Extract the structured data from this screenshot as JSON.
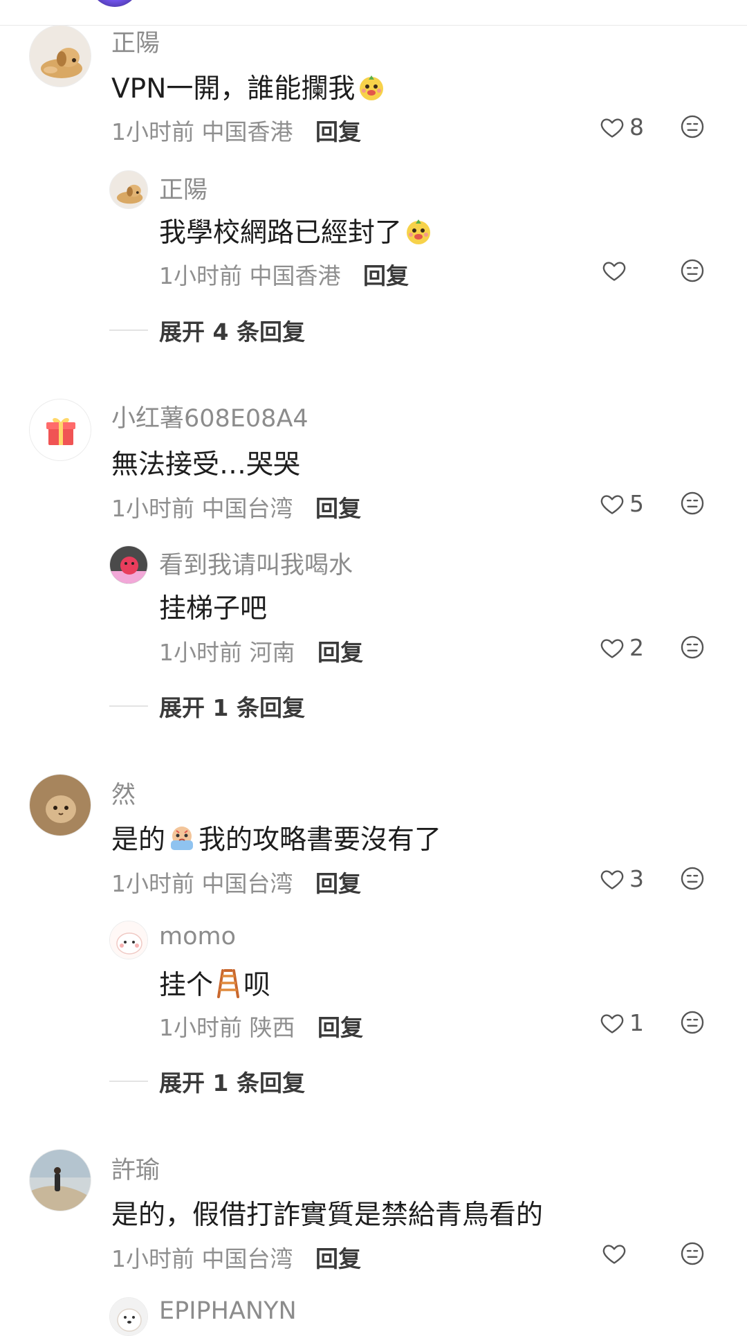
{
  "comments": [
    {
      "name": "正陽",
      "text": "VPN一開，誰能攔我",
      "time": "1小时前",
      "location": "中国香港",
      "reply_label": "回复",
      "likes": "8",
      "avatar": "puppy-avatar",
      "replies": [
        {
          "name": "正陽",
          "text": "我學校網路已經封了",
          "time": "1小时前",
          "location": "中国香港",
          "reply_label": "回复",
          "likes": "",
          "avatar": "puppy-avatar"
        }
      ],
      "expand_label": "展开 4 条回复"
    },
    {
      "name": "小红薯608E08A4",
      "text": "無法接受…哭哭",
      "time": "1小时前",
      "location": "中国台湾",
      "reply_label": "回复",
      "likes": "5",
      "avatar": "gift-icon",
      "replies": [
        {
          "name": "看到我请叫我喝水",
          "text": "挂梯子吧",
          "time": "1小时前",
          "location": "河南",
          "reply_label": "回复",
          "likes": "2",
          "avatar": "pink-bird-avatar"
        }
      ],
      "expand_label": "展开 1 条回复"
    },
    {
      "name": "然",
      "text_part1": "是的",
      "text_part2": "我的攻略書要沒有了",
      "time": "1小时前",
      "location": "中国台湾",
      "reply_label": "回复",
      "likes": "3",
      "avatar": "cat-avatar",
      "replies": [
        {
          "name": "momo",
          "text_part1": "挂个",
          "text_part2": "呗",
          "time": "1小时前",
          "location": "陕西",
          "reply_label": "回复",
          "likes": "1",
          "avatar": "seal-avatar"
        }
      ],
      "expand_label": "展开 1 条回复"
    },
    {
      "name": "許瑜",
      "text": "是的，假借打詐實質是禁給青鳥看的",
      "time": "1小时前",
      "location": "中国台湾",
      "reply_label": "回复",
      "likes": "",
      "avatar": "person-avatar",
      "replies": [
        {
          "name": "EPIPHANYN",
          "avatar": "dog-avatar"
        }
      ]
    }
  ],
  "colors": {
    "name": "#8c8c8c",
    "text": "#1d1d1d",
    "meta": "#8f8f8f",
    "reply": "#3a3a3a",
    "icon": "#595959"
  }
}
